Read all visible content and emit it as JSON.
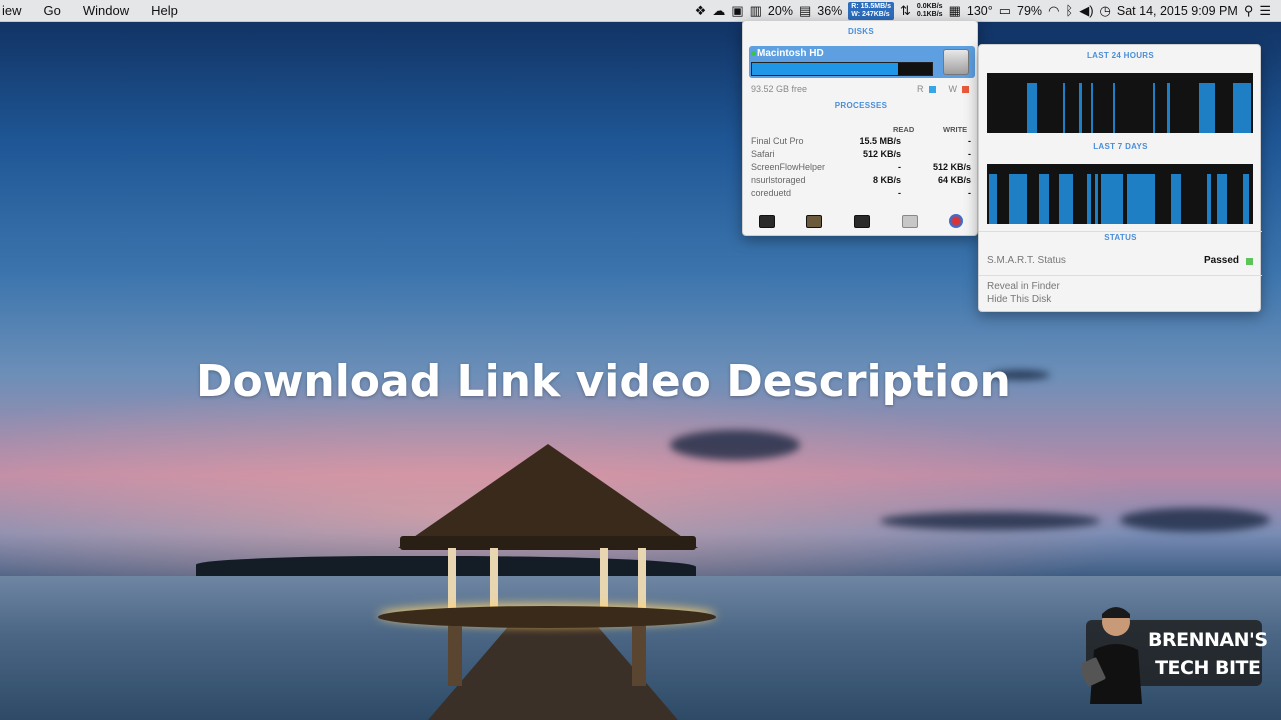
{
  "menubar": {
    "items": [
      "iew",
      "Go",
      "Window",
      "Help"
    ],
    "battery_pct_1": "20%",
    "cpu_pct": "36%",
    "io": {
      "r_label": "R:",
      "r_val": "15.5MB/s",
      "w_label": "W:",
      "w_val": "247KB/s"
    },
    "net": {
      "up": "0.0KB/s",
      "down": "0.1KB/s"
    },
    "temp": "130°",
    "battery_pct_2": "79%",
    "datetime": "Sat 14, 2015  9:09 PM",
    "icons": [
      "dropbox-icon",
      "cloud-icon",
      "camera-icon",
      "memory-icon",
      "disk-activity-icon",
      "network-icon",
      "fan-icon",
      "battery-icon",
      "wifi-icon",
      "bluetooth-icon",
      "volume-icon",
      "time-machine-icon",
      "spotlight-icon",
      "notification-center-icon"
    ]
  },
  "disks_panel": {
    "disks_title": "DISKS",
    "disk_name": "Macintosh HD",
    "used_fraction": 0.81,
    "free_text": "93.52 GB free",
    "legend_r": "R",
    "legend_w": "W",
    "read_color": "#35a6e8",
    "write_color": "#e85a3a",
    "processes_title": "PROCESSES",
    "col_read": "READ",
    "col_write": "WRITE",
    "processes": [
      {
        "name": "Final Cut Pro",
        "read": "15.5 MB/s",
        "write": "-"
      },
      {
        "name": "Safari",
        "read": "512 KB/s",
        "write": "-"
      },
      {
        "name": "ScreenFlowHelper",
        "read": "-",
        "write": "512 KB/s"
      },
      {
        "name": "nsurlstoraged",
        "read": "8 KB/s",
        "write": "64 KB/s"
      },
      {
        "name": "coreduetd",
        "read": "-",
        "write": "-"
      }
    ],
    "toolbar_icons": [
      "activity-monitor-icon",
      "console-icon",
      "terminal-icon",
      "disk-utility-icon",
      "istat-icon"
    ]
  },
  "detail_panel": {
    "last24_title": "LAST 24 HOURS",
    "last7_title": "LAST 7 DAYS",
    "status_title": "STATUS",
    "smart_label": "S.M.A.R.T. Status",
    "smart_value": "Passed",
    "smart_color": "#5cc45a",
    "reveal": "Reveal in Finder",
    "hide": "Hide This Disk"
  },
  "overlay": {
    "headline": "Download Link video Description",
    "badge_line1": "BRENNAN'S",
    "badge_line2": "TECH BITE"
  }
}
